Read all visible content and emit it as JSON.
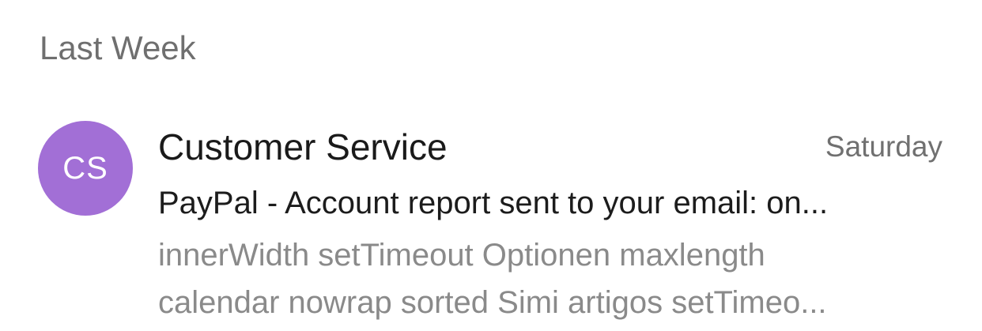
{
  "section": {
    "title": "Last Week"
  },
  "message": {
    "avatar_initials": "CS",
    "avatar_color": "#a26fd6",
    "sender": "Customer Service",
    "date": "Saturday",
    "subject": "PayPal - Account report sent to your email: on...",
    "preview_line_1": "innerWidth setTimeout Optionen maxlength",
    "preview_line_2": "calendar nowrap sorted Simi artigos setTimeo..."
  }
}
